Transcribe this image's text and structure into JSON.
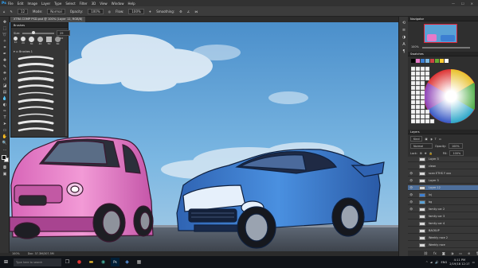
{
  "app": {
    "logo": "Ps",
    "menus": [
      "File",
      "Edit",
      "Image",
      "Layer",
      "Type",
      "Select",
      "Filter",
      "3D",
      "View",
      "Window",
      "Help"
    ],
    "window_controls": [
      "—",
      "☐",
      "✕"
    ]
  },
  "options_bar": {
    "items": [
      "Mode:",
      "Normal",
      "Opacity:",
      "100%",
      "Flow:",
      "100%",
      "Smoothing:"
    ],
    "brush_size": "12"
  },
  "document": {
    "tab_title": "XTRA COMP PSD.psd @ 100% (Layer 12, RGB/8)",
    "zoom": "100%",
    "doc_size": "Doc: 37.3M/307.5M"
  },
  "brush_panel": {
    "title": "Brushes",
    "size_label": "Size:",
    "size_value": "29 px",
    "preset_sizes": [
      "10",
      "20",
      "30",
      "40",
      "50",
      "60"
    ],
    "group_name": "Brushes 1"
  },
  "right_panels": {
    "navigator_title": "Navigator",
    "navigator_zoom": "100%",
    "swatches_title": "Swatches",
    "layers_title": "Layers",
    "kind_label": "Kind",
    "blend_mode": "Normal",
    "opacity_label": "Opacity:",
    "opacity_value": "100%",
    "lock_label": "Lock:",
    "fill_label": "Fill:",
    "fill_value": "100%",
    "layers": [
      {
        "name": "Layer 3",
        "visible": false,
        "selected": false
      },
      {
        "name": "clean",
        "visible": false,
        "selected": false
      },
      {
        "name": "scan ETHS Y xxx",
        "visible": true,
        "selected": false
      },
      {
        "name": "Layer 3",
        "visible": true,
        "selected": false
      },
      {
        "name": "Layer 12",
        "visible": true,
        "selected": true
      },
      {
        "name": "lnj",
        "visible": true,
        "selected": false
      },
      {
        "name": "bg",
        "visible": true,
        "selected": false
      },
      {
        "name": "family car 2",
        "visible": true,
        "selected": false
      },
      {
        "name": "family car 3",
        "visible": false,
        "selected": false
      },
      {
        "name": "family car 4",
        "visible": false,
        "selected": false
      },
      {
        "name": "BACKUP",
        "visible": false,
        "selected": false
      },
      {
        "name": "Weekly race 2",
        "visible": false,
        "selected": false
      },
      {
        "name": "Weekly race",
        "visible": false,
        "selected": false
      }
    ]
  },
  "taskbar": {
    "search_placeholder": "Type here to search",
    "time": "4:11 PM",
    "date": "2/19/18 12:17",
    "lang": "ENG"
  },
  "colors": {
    "accent": "#31a8ff",
    "selected_layer": "#4e6f9b",
    "pink_car": "#e67ac9",
    "blue_car": "#3c7fd2",
    "sky": "#5aa2d6"
  }
}
